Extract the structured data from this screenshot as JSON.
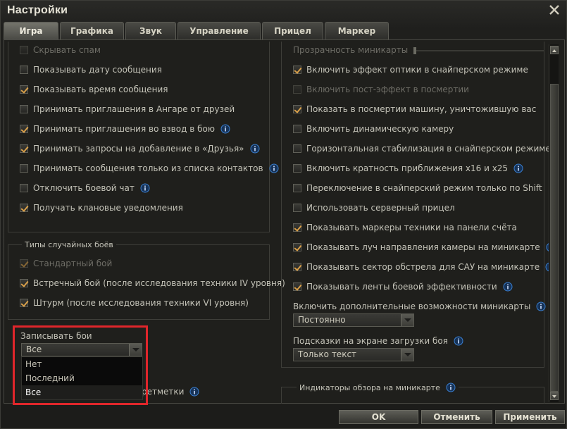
{
  "window": {
    "title": "Настройки"
  },
  "tabs": [
    {
      "label": "Игра",
      "active": true
    },
    {
      "label": "Графика"
    },
    {
      "label": "Звук"
    },
    {
      "label": "Управление"
    },
    {
      "label": "Прицел"
    },
    {
      "label": "Маркер"
    }
  ],
  "left": {
    "items": [
      {
        "label": "Скрывать спам",
        "checked": false
      },
      {
        "label": "Показывать дату сообщения",
        "checked": false
      },
      {
        "label": "Показывать время сообщения",
        "checked": true
      },
      {
        "label": "Принимать приглашения в Ангаре от друзей",
        "checked": false
      },
      {
        "label": "Принимать приглашения во взвод в бою",
        "checked": true
      },
      {
        "label": "Принимать запросы на добавление в «Друзья»",
        "checked": true
      },
      {
        "label": "Принимать сообщения только из списка контактов",
        "checked": false
      },
      {
        "label": "Отключить боевой чат",
        "checked": false
      },
      {
        "label": "Получать клановые уведомления",
        "checked": true
      }
    ],
    "battle_types_title": "Типы случайных боёв",
    "battle_types": [
      {
        "label": "Стандартный бой",
        "checked": true
      },
      {
        "label": "Встречный бой (после исследования техники IV уровня)",
        "checked": true
      },
      {
        "label": "Штурм (после исследования техники VI уровня)",
        "checked": true
      }
    ],
    "record_label": "Записывать бои",
    "record_value": "Все",
    "record_options": [
      "Нет",
      "Последний",
      "Все"
    ],
    "hidden_row_tail": "ретметки"
  },
  "right": {
    "minimap_opacity_label": "Прозрачность миникарты",
    "minimap_opacity": 0,
    "items": [
      {
        "label": "Включить эффект оптики в снайперском режиме",
        "checked": true
      },
      {
        "label": "Включить пост-эффект в посмертии",
        "checked": false
      },
      {
        "label": "Показать в посмертии машину, уничтожившую вас",
        "checked": true
      },
      {
        "label": "Включить динамическую камеру",
        "checked": false
      },
      {
        "label": "Горизонтальная стабилизация в снайперском режиме",
        "checked": false
      },
      {
        "label": "Включить кратность приближения x16 и x25",
        "checked": false
      },
      {
        "label": "Переключение в снайперский режим только по Shift",
        "checked": false
      },
      {
        "label": "Использовать серверный прицел",
        "checked": false
      },
      {
        "label": "Показывать маркеры техники на панели счёта",
        "checked": true
      },
      {
        "label": "Показывать луч направления камеры на миникарте",
        "checked": true
      },
      {
        "label": "Показывать сектор обстрела для САУ на миникарте",
        "checked": true
      },
      {
        "label": "Показывать ленты боевой эффективности",
        "checked": true
      }
    ],
    "minimap_extra_label": "Включить дополнительные возможности миникарты",
    "minimap_extra_value": "Постоянно",
    "hints_label": "Подсказки на экране загрузки боя",
    "hints_value": "Только текст",
    "indicators_title": "Индикаторы обзора на миникарте"
  },
  "buttons": {
    "ok": "OK",
    "cancel": "Отменить",
    "apply": "Применить"
  },
  "colors": {
    "accent": "#d9a04a",
    "highlight": "#e0262b",
    "info": "#3a7fd0"
  }
}
